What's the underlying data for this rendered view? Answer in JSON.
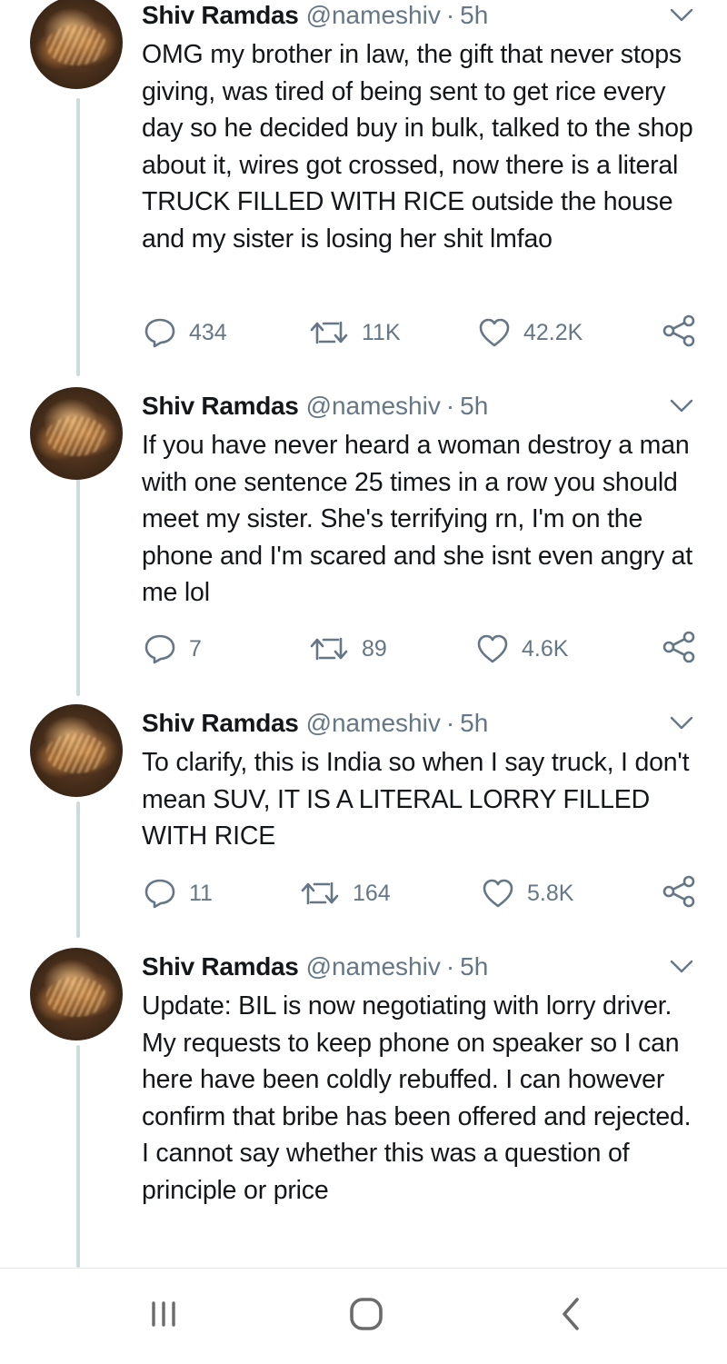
{
  "tweets": [
    {
      "name": "Shiv Ramdas",
      "handle": "@nameshiv",
      "dot": "·",
      "time": "5h",
      "text": "OMG my brother in law, the gift that never stops giving, was tired of being sent to get rice every day so he decided buy in bulk, talked to the shop about it, wires got crossed, now there is a literal TRUCK FILLED WITH RICE outside the house and my sister is losing her shit lmfao",
      "replies": "434",
      "retweets": "11K",
      "likes": "42.2K"
    },
    {
      "name": "Shiv Ramdas",
      "handle": "@nameshiv",
      "dot": "·",
      "time": "5h",
      "text": "If you have never heard a woman destroy a man with one sentence 25 times in a row you should meet my sister. She's terrifying rn, I'm on the phone and I'm scared and she isnt even angry at me lol",
      "replies": "7",
      "retweets": "89",
      "likes": "4.6K"
    },
    {
      "name": "Shiv Ramdas",
      "handle": "@nameshiv",
      "dot": "·",
      "time": "5h",
      "text": "To clarify, this is India so when I say truck, I don't mean SUV, IT IS A LITERAL LORRY FILLED WITH RICE",
      "replies": "11",
      "retweets": "164",
      "likes": "5.8K"
    },
    {
      "name": "Shiv Ramdas",
      "handle": "@nameshiv",
      "dot": "·",
      "time": "5h",
      "text": "Update: BIL is now negotiating with lorry driver. My requests to keep phone on speaker so I can here have been coldly rebuffed. I can however confirm that bribe has been offered and rejected. I cannot say whether this was a question of principle or price"
    }
  ],
  "icons": {
    "reply": "reply-icon",
    "retweet": "retweet-icon",
    "like": "heart-icon",
    "share": "share-icon",
    "more": "chevron-down-icon",
    "nav_recents": "recents-icon",
    "nav_home": "home-icon",
    "nav_back": "back-icon"
  },
  "colors": {
    "text": "#14171a",
    "secondary": "#657786",
    "thread_line": "#cfd9de"
  }
}
